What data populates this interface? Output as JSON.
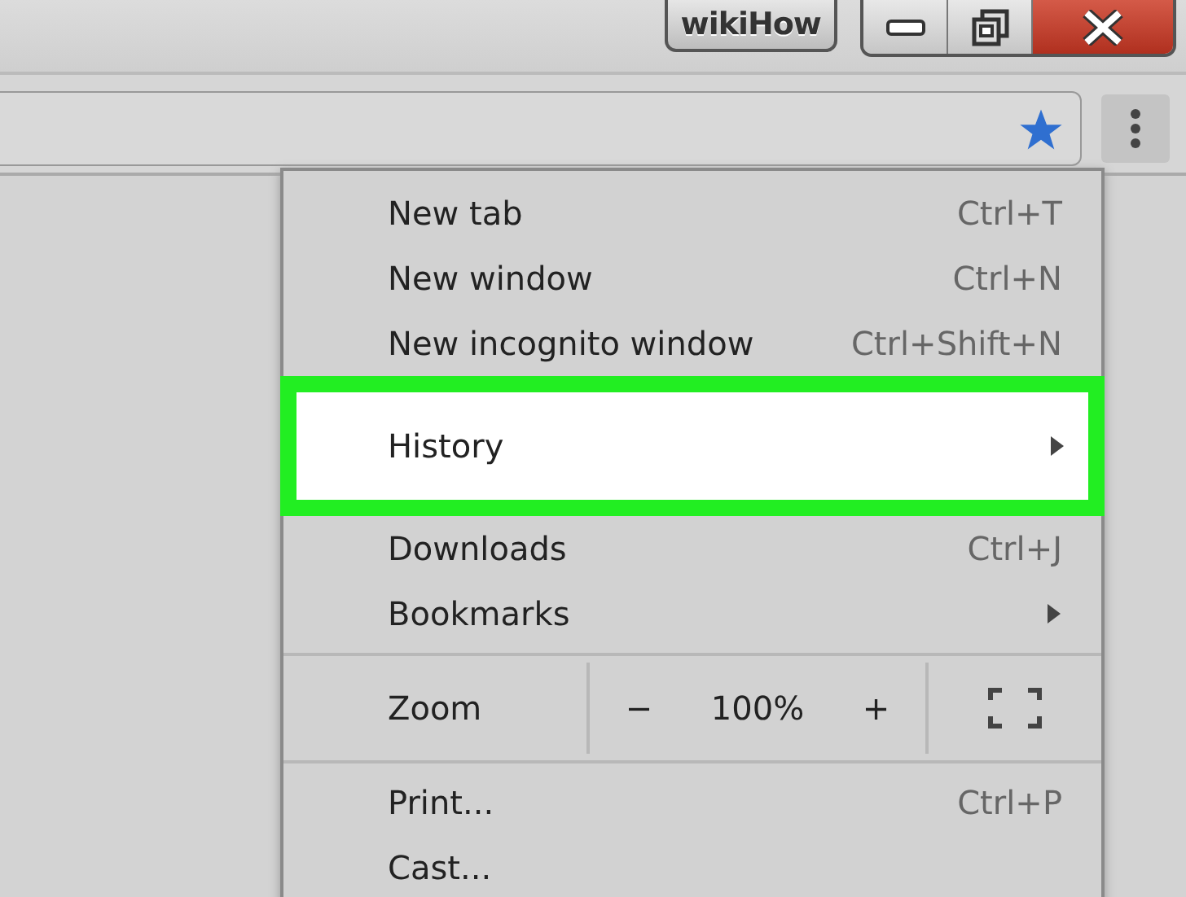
{
  "title_bar": {
    "profile_button": "wikiHow"
  },
  "menu": {
    "items": [
      {
        "kind": "item",
        "label": "New tab",
        "shortcut": "Ctrl+T",
        "submenu": false,
        "selected": false
      },
      {
        "kind": "item",
        "label": "New window",
        "shortcut": "Ctrl+N",
        "submenu": false,
        "selected": false
      },
      {
        "kind": "item",
        "label": "New incognito window",
        "shortcut": "Ctrl+Shift+N",
        "submenu": false,
        "selected": false
      },
      {
        "kind": "item",
        "label": "History",
        "submenu": true,
        "selected": true
      },
      {
        "kind": "item",
        "label": "Downloads",
        "shortcut": "Ctrl+J",
        "submenu": false,
        "selected": false
      },
      {
        "kind": "item",
        "label": "Bookmarks",
        "submenu": true,
        "selected": false
      },
      {
        "kind": "separator"
      },
      {
        "kind": "zoom",
        "label": "Zoom",
        "minus": "−",
        "value": "100%",
        "plus": "+"
      },
      {
        "kind": "separator"
      },
      {
        "kind": "item",
        "label": "Print...",
        "shortcut": "Ctrl+P",
        "submenu": false,
        "selected": false
      },
      {
        "kind": "item",
        "label": "Cast...",
        "submenu": false,
        "selected": false
      }
    ]
  }
}
